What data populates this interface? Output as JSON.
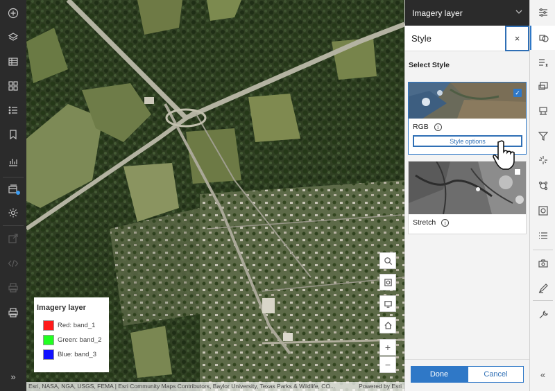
{
  "left_toolbar": {
    "icons": [
      "add-icon",
      "layers-icon",
      "table-icon",
      "basemap-icon",
      "legend-icon",
      "bookmark-icon",
      "chart-icon",
      "layer-properties-icon",
      "settings-icon",
      "share-icon",
      "embed-icon",
      "print-icon",
      "expand-icon"
    ],
    "expand_label": "»"
  },
  "map": {
    "attribution": "Esri, NASA, NGA, USGS, FEMA | Esri Community Maps Contributors, Baylor University, Texas Parks & Wildlife, CO...",
    "powered_by": "Powered by Esri",
    "zoom_in_label": "+",
    "zoom_out_label": "−"
  },
  "legend": {
    "title": "Imagery layer",
    "items": [
      {
        "label": "Red: band_1",
        "color": "#ff1a1a"
      },
      {
        "label": "Green: band_2",
        "color": "#22ff22"
      },
      {
        "label": "Blue: band_3",
        "color": "#1111ff"
      }
    ]
  },
  "panel": {
    "layer_title": "Imagery layer",
    "section_title": "Style",
    "close_label": "×",
    "select_style_label": "Select Style",
    "styles": [
      {
        "name": "RGB",
        "selected": true,
        "options_label": "Style options"
      },
      {
        "name": "Stretch",
        "selected": false
      }
    ],
    "done_label": "Done",
    "cancel_label": "Cancel"
  },
  "right_toolbar": {
    "icons": [
      "properties-icon",
      "styles-icon",
      "fields-icon",
      "pop-ups-icon",
      "labels-icon",
      "filter-icon",
      "effects-icon",
      "analysis-icon",
      "raster-functions-icon",
      "list-icon",
      "image-collection-icon",
      "sketch-icon",
      "tools-icon",
      "collapse-icon"
    ],
    "collapse_label": "«"
  },
  "colors": {
    "accent": "#2f78c7",
    "dark": "#2b2b2b"
  }
}
